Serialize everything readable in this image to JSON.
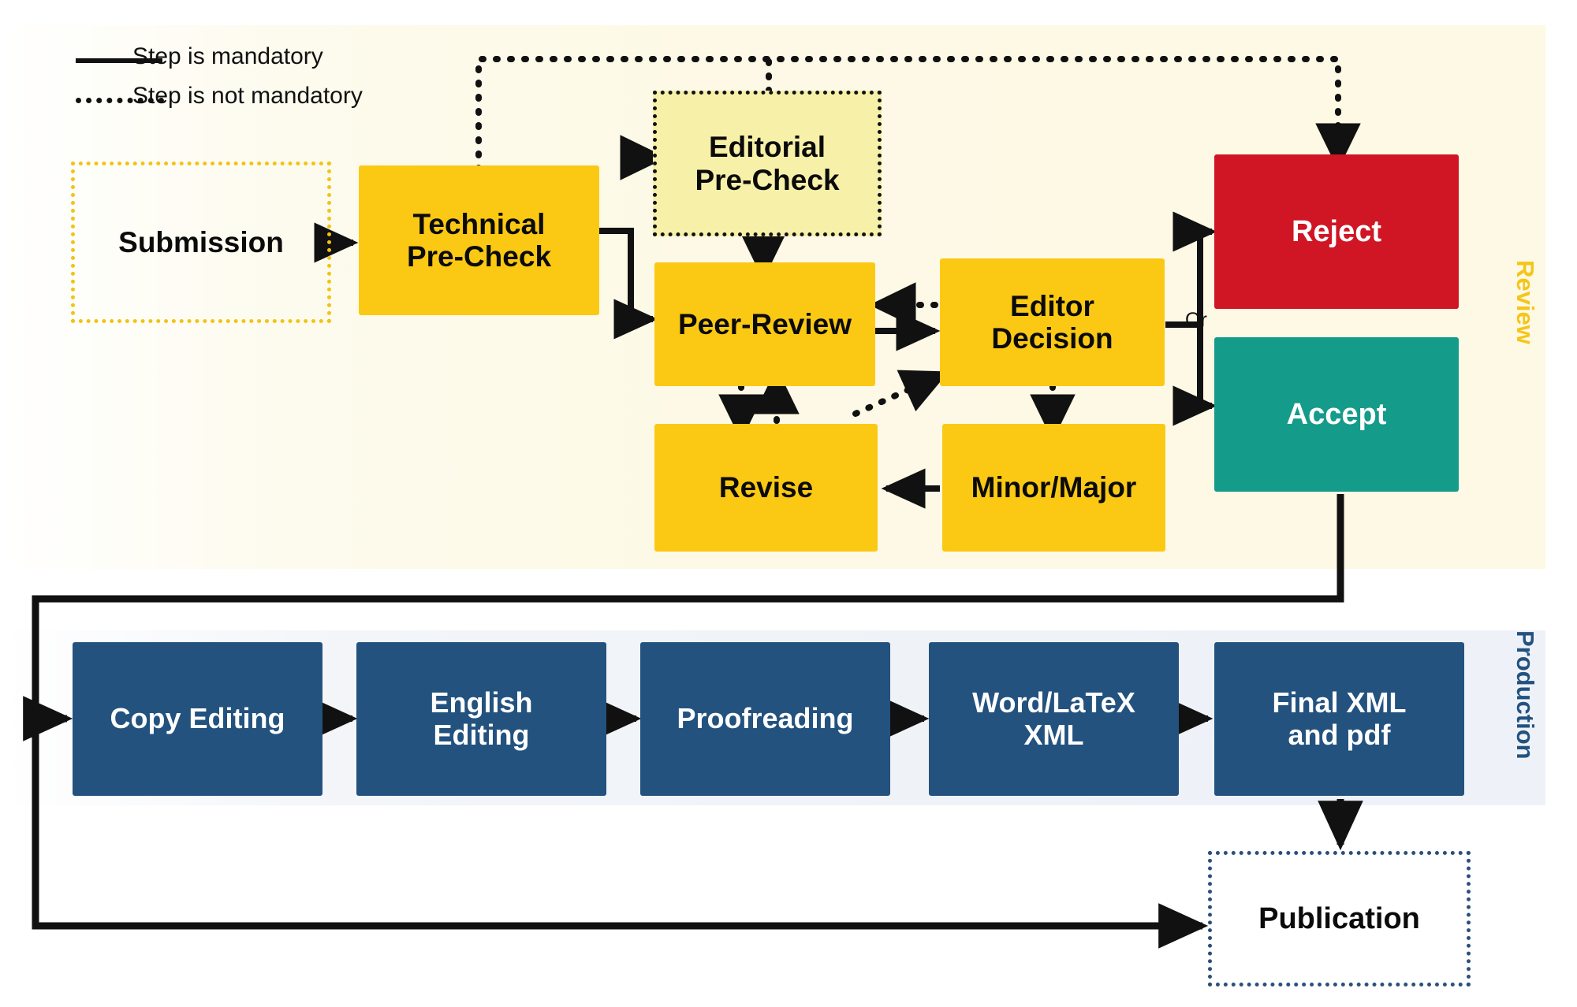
{
  "legend": {
    "items": [
      {
        "style": "solid",
        "label": "Step is mandatory"
      },
      {
        "style": "dotted",
        "label": "Step is not mandatory"
      }
    ]
  },
  "regions": {
    "review": {
      "label": "Review",
      "color": "#F5C518",
      "background": "#FDF9E6"
    },
    "production": {
      "label": "Production",
      "color": "#23527F",
      "background": "#EEF2F8"
    }
  },
  "nodes": {
    "submission": {
      "label": "Submission",
      "style": "dotted-yellow-outline"
    },
    "technical_precheck": {
      "label": "Technical\nPre-Check",
      "style": "yellow-filled"
    },
    "editorial_precheck": {
      "label": "Editorial\nPre-Check",
      "style": "light-yellow-dotted"
    },
    "peer_review": {
      "label": "Peer-Review",
      "style": "yellow-filled"
    },
    "editor_decision": {
      "label": "Editor\nDecision",
      "style": "yellow-filled"
    },
    "revise": {
      "label": "Revise",
      "style": "yellow-filled"
    },
    "minor_major": {
      "label": "Minor/Major",
      "style": "yellow-filled"
    },
    "reject": {
      "label": "Reject",
      "style": "red-filled"
    },
    "accept": {
      "label": "Accept",
      "style": "teal-filled"
    },
    "copy_editing": {
      "label": "Copy Editing",
      "style": "navy-filled"
    },
    "english_editing": {
      "label": "English\nEditing",
      "style": "navy-filled"
    },
    "proofreading": {
      "label": "Proofreading",
      "style": "navy-filled"
    },
    "word_latex_xml": {
      "label": "Word/LaTeX\nXML",
      "style": "navy-filled"
    },
    "final_xml_pdf": {
      "label": "Final XML\nand pdf",
      "style": "navy-filled"
    },
    "publication": {
      "label": "Publication",
      "style": "dotted-blue-outline"
    }
  },
  "edges": {
    "or_label": "Or",
    "list": [
      {
        "from": "submission",
        "to": "technical_precheck",
        "style": "solid"
      },
      {
        "from": "technical_precheck",
        "to": "editorial_precheck",
        "style": "dotted"
      },
      {
        "from": "technical_precheck",
        "to": "peer_review",
        "style": "solid"
      },
      {
        "from": "technical_precheck",
        "to": "reject",
        "style": "dotted"
      },
      {
        "from": "editorial_precheck",
        "to": "peer_review",
        "style": "dotted"
      },
      {
        "from": "peer_review",
        "to": "editor_decision",
        "style": "solid"
      },
      {
        "from": "editor_decision",
        "to": "peer_review",
        "style": "dotted"
      },
      {
        "from": "peer_review",
        "to": "revise",
        "style": "dotted"
      },
      {
        "from": "revise",
        "to": "peer_review",
        "style": "dotted"
      },
      {
        "from": "revise",
        "to": "editor_decision",
        "style": "dotted"
      },
      {
        "from": "editor_decision",
        "to": "minor_major",
        "style": "dotted"
      },
      {
        "from": "minor_major",
        "to": "revise",
        "style": "solid"
      },
      {
        "from": "editor_decision",
        "to": "reject",
        "style": "solid"
      },
      {
        "from": "editor_decision",
        "to": "accept",
        "style": "solid"
      },
      {
        "from": "accept",
        "to": "copy_editing",
        "style": "solid"
      },
      {
        "from": "copy_editing",
        "to": "english_editing",
        "style": "solid"
      },
      {
        "from": "english_editing",
        "to": "proofreading",
        "style": "solid"
      },
      {
        "from": "proofreading",
        "to": "word_latex_xml",
        "style": "solid"
      },
      {
        "from": "word_latex_xml",
        "to": "final_xml_pdf",
        "style": "solid"
      },
      {
        "from": "final_xml_pdf",
        "to": "publication",
        "style": "solid"
      },
      {
        "from": "accept",
        "to": "publication",
        "style": "solid"
      }
    ]
  },
  "colors": {
    "yellow": "#FBC913",
    "light_yellow": "#F7F0A8",
    "navy": "#23527F",
    "red": "#D01524",
    "teal": "#159B8A",
    "line": "#111111",
    "dotted_blue": "#2C4F7C",
    "dotted_yellow": "#F3C315"
  }
}
